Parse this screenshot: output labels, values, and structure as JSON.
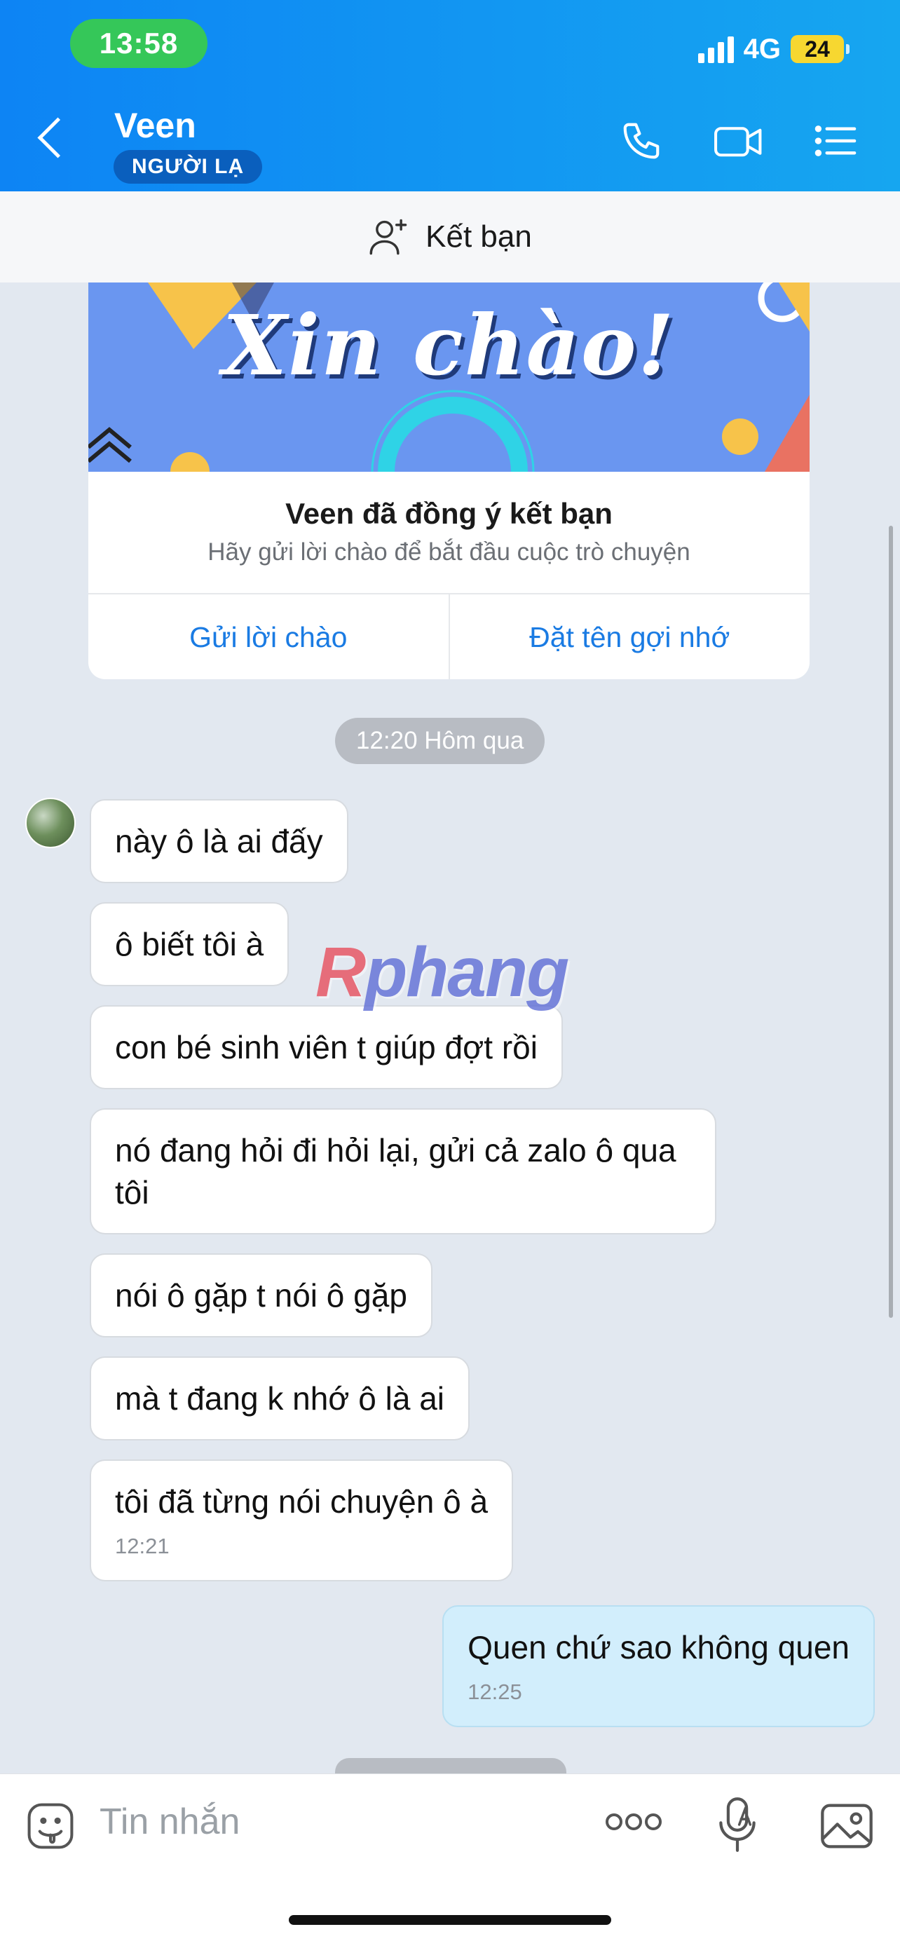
{
  "status_bar": {
    "time": "13:58",
    "network": "4G",
    "battery": "24"
  },
  "header": {
    "contact_name": "Veen",
    "badge": "NGƯỜI LẠ"
  },
  "add_friend": {
    "label": "Kết bạn"
  },
  "hello_card": {
    "banner_text": "Xin chào!",
    "title": "Veen đã đồng ý kết bạn",
    "subtitle": "Hãy gửi lời chào để bắt đầu cuộc trò chuyện",
    "action_greet": "Gửi lời chào",
    "action_nickname": "Đặt tên gợi nhớ"
  },
  "date_separator": "12:20 Hôm qua",
  "messages": [
    {
      "text": "này ô là ai đấy"
    },
    {
      "text": "ô biết tôi à"
    },
    {
      "text": "con bé sinh viên t giúp đợt rồi"
    },
    {
      "text": "nó đang hỏi đi hỏi lại, gửi cả zalo ô qua tôi"
    },
    {
      "text": "nói ô gặp t nói ô gặp"
    },
    {
      "text": "mà t đang k nhớ ô là ai"
    },
    {
      "text": "tôi đã từng nói chuyện ô à",
      "time": "12:21"
    },
    {
      "text": "Quen chứ sao không quen",
      "time": "12:25",
      "sender": "me"
    }
  ],
  "watermark": {
    "first": "R",
    "rest": "phang"
  },
  "composer": {
    "placeholder": "Tin nhắn"
  },
  "colors": {
    "header": "#0d84f4",
    "accent": "#1a7be3",
    "my_bubble": "#d2eefc"
  }
}
